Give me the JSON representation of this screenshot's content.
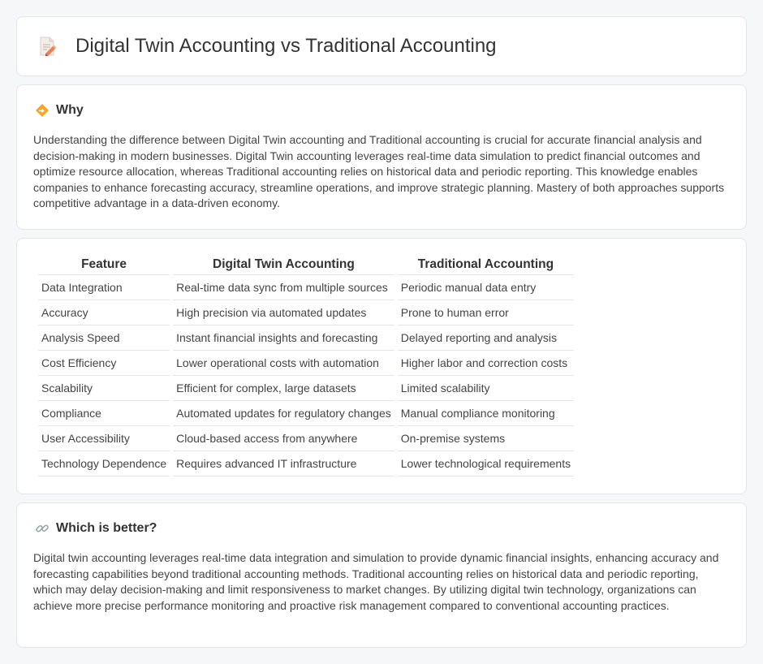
{
  "header": {
    "title": "Digital Twin Accounting vs Traditional Accounting"
  },
  "why": {
    "heading": "Why",
    "text": "Understanding the difference between Digital Twin accounting and Traditional accounting is crucial for accurate financial analysis and decision-making in modern businesses. Digital Twin accounting leverages real-time data simulation to predict financial outcomes and optimize resource allocation, whereas Traditional accounting relies on historical data and periodic reporting. This knowledge enables companies to enhance forecasting accuracy, streamline operations, and improve strategic planning. Mastery of both approaches supports competitive advantage in a data-driven economy."
  },
  "comparison": {
    "headers": [
      "Feature",
      "Digital Twin Accounting",
      "Traditional Accounting"
    ],
    "rows": [
      [
        "Data Integration",
        "Real-time data sync from multiple sources",
        "Periodic manual data entry"
      ],
      [
        "Accuracy",
        "High precision via automated updates",
        "Prone to human error"
      ],
      [
        "Analysis Speed",
        "Instant financial insights and forecasting",
        "Delayed reporting and analysis"
      ],
      [
        "Cost Efficiency",
        "Lower operational costs with automation",
        "Higher labor and correction costs"
      ],
      [
        "Scalability",
        "Efficient for complex, large datasets",
        "Limited scalability"
      ],
      [
        "Compliance",
        "Automated updates for regulatory changes",
        "Manual compliance monitoring"
      ],
      [
        "User Accessibility",
        "Cloud-based access from anywhere",
        "On-premise systems"
      ],
      [
        "Technology Dependence",
        "Requires advanced IT infrastructure",
        "Lower technological requirements"
      ]
    ]
  },
  "better": {
    "heading": "Which is better?",
    "text": "Digital twin accounting leverages real-time data integration and simulation to provide dynamic financial insights, enhancing accuracy and forecasting capabilities beyond traditional accounting methods. Traditional accounting relies on historical data and periodic reporting, which may delay decision-making and limit responsiveness to market changes. By utilizing digital twin technology, organizations can achieve more precise performance monitoring and proactive risk management compared to conventional accounting practices."
  },
  "icons": {
    "header": "document-pencil-icon",
    "why": "warning-diamond-icon",
    "better": "link-icon"
  },
  "colors": {
    "background": "#f6f7f9",
    "card": "#ffffff",
    "border": "#e3e5e8",
    "accent_orange": "#f5a623"
  }
}
